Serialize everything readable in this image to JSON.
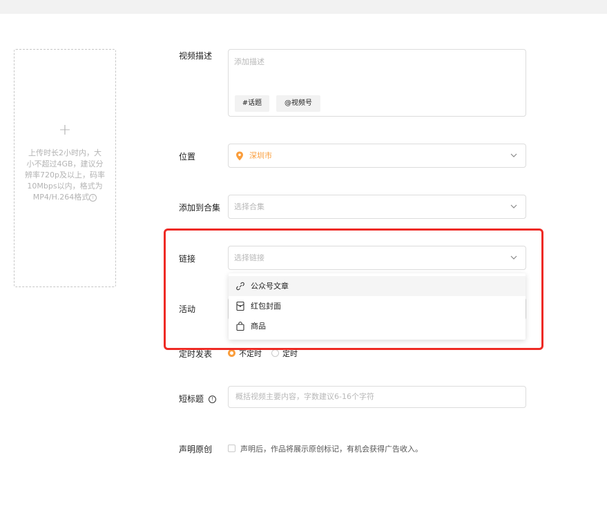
{
  "upload": {
    "plus": "+",
    "hint": "上传时长2小时内，大小不超过4GB，建议分辨率720p及以上，码率10Mbps以内，格式为MP4/H.264格式",
    "info_icon": "info-icon"
  },
  "description": {
    "label": "视频描述",
    "placeholder": "添加描述",
    "tag_topic": "#话题",
    "tag_channel": "@视频号"
  },
  "location": {
    "label": "位置",
    "value": "深圳市",
    "icon": "location-pin-icon"
  },
  "collection": {
    "label": "添加到合集",
    "placeholder": "选择合集"
  },
  "link": {
    "label": "链接",
    "placeholder": "选择链接",
    "options": [
      {
        "label": "公众号文章",
        "icon": "link-icon"
      },
      {
        "label": "红包封面",
        "icon": "red-packet-icon"
      },
      {
        "label": "商品",
        "icon": "shopping-bag-icon"
      }
    ]
  },
  "activity": {
    "label": "活动"
  },
  "schedule": {
    "label": "定时发表",
    "option_now": "不定时",
    "option_timed": "定时",
    "selected": "不定时"
  },
  "short_title": {
    "label": "短标题",
    "placeholder": "概括视频主要内容，字数建议6-16个字符"
  },
  "original": {
    "label": "声明原创",
    "text": "声明后，作品将展示原创标记，有机会获得广告收入。"
  },
  "colors": {
    "accent": "#fa9d3b",
    "highlight_border": "#ee2a24"
  }
}
